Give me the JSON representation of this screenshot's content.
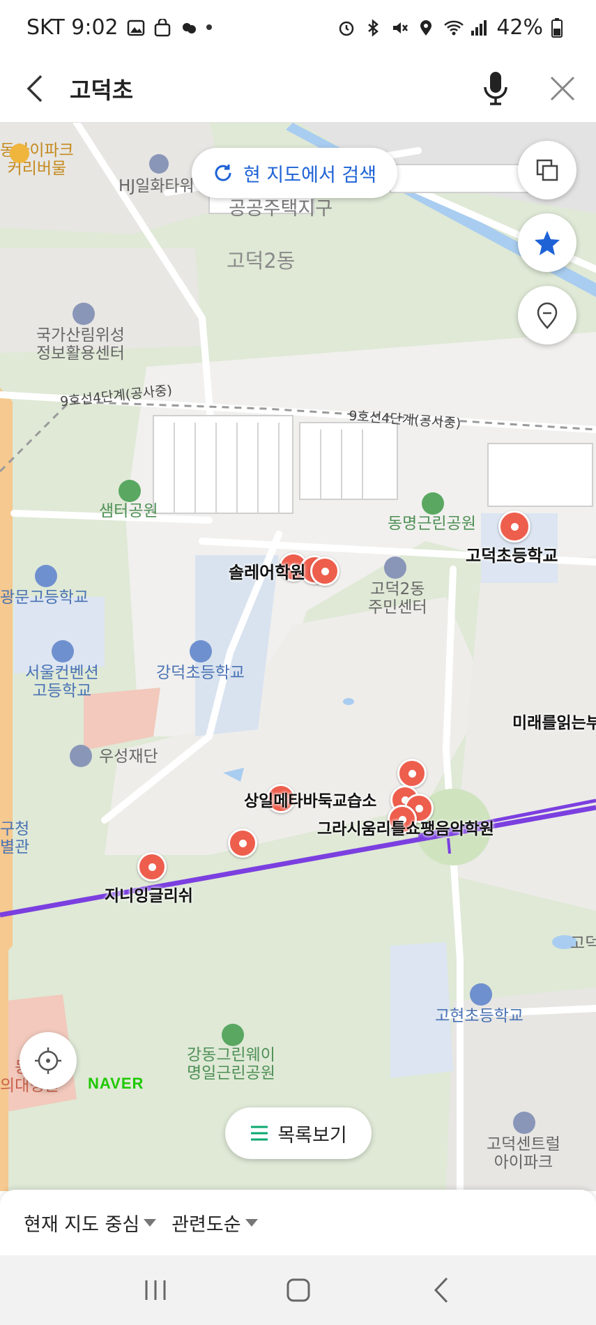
{
  "status": {
    "carrier_time": "SKT 9:02",
    "battery": "42%"
  },
  "search": {
    "query": "고덕초"
  },
  "map": {
    "search_here": "현 지도에서 검색",
    "list_view": "목록보기",
    "logo": "NAVER",
    "labels": {
      "mall": "동아이파크\n커리버물",
      "hj": "HJ일화타워",
      "housing": "공공주택지구",
      "dong": "고덕2동",
      "satellite": "국가산림위성\n정보활용센터",
      "rail1": "9호선4단계(공사중)",
      "rail2": "9호선4단계(공사중)",
      "samter_park": "샘터공원",
      "dongmyeong_park": "동명근린공원",
      "godeok_elem": "고덕초등학교",
      "solre": "솔레어학원",
      "community": "고덕2동\n주민센터",
      "gwangmun": "광문고등학교",
      "seoul_conv": "서울컨벤션\n고등학교",
      "gangdeok": "강덕초등학교",
      "future": "미래를읽는부",
      "woosung": "우성재단",
      "gu_office": "구청\n별관",
      "sangil": "상일메타바둑교습소",
      "grace": "그라시움리틀쇼팽음악학원",
      "jiny": "지니잉글리쉬",
      "godeok_right": "고덕",
      "gohyeon": "고현초등학교",
      "greenway": "강동그린웨이\n명일근린공원",
      "hospital": "동경\n의대병원",
      "central": "고덕센트럴\n아이파크"
    }
  },
  "sheet": {
    "filter_center": "현재 지도 중심",
    "filter_sort": "관련도순"
  },
  "colors": {
    "accent": "#1e62d6",
    "marker": "#ee5e4d",
    "subway": "#7b3fe0",
    "naver": "#1ec800"
  }
}
